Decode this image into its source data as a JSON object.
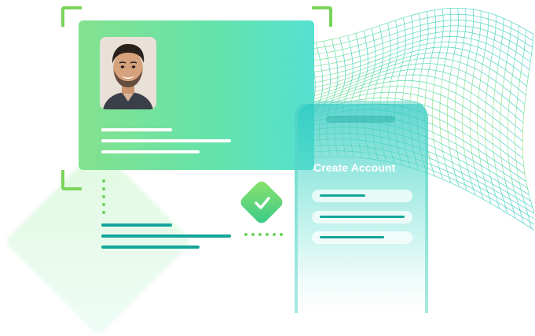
{
  "phone": {
    "title": "Create Account",
    "fields": [
      "name-field",
      "email-field",
      "password-field"
    ]
  },
  "card": {
    "photo": "user-portrait"
  },
  "icons": {
    "verify": "checkmark-icon"
  },
  "colors": {
    "accent_green": "#7ad45a",
    "accent_teal": "#14a59a",
    "card_gradient_start": "#7fe08a",
    "card_gradient_end": "#4fdfcf"
  }
}
